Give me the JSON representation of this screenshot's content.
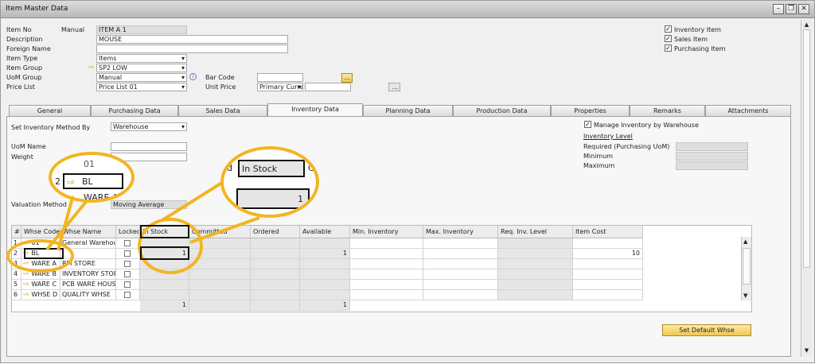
{
  "window": {
    "title": "Item Master Data"
  },
  "header": {
    "item_no_label": "Item No",
    "item_no_series": "Manual",
    "item_no_value": "ITEM A 1",
    "description_label": "Description",
    "description_value": "MOUSE",
    "foreign_name_label": "Foreign Name",
    "foreign_name_value": "",
    "item_type_label": "Item Type",
    "item_type_value": "Items",
    "item_group_label": "Item Group",
    "item_group_value": "SP2 LOW",
    "uom_group_label": "UoM Group",
    "uom_group_value": "Manual",
    "price_list_label": "Price List",
    "price_list_value": "Price List 01",
    "bar_code_label": "Bar Code",
    "bar_code_value": "",
    "unit_price_label": "Unit Price",
    "unit_price_currency": "Primary Curre",
    "unit_price_value": ""
  },
  "flags": [
    {
      "label": "Inventory Item",
      "checked": true
    },
    {
      "label": "Sales Item",
      "checked": true
    },
    {
      "label": "Purchasing Item",
      "checked": true
    }
  ],
  "tabs": [
    "General",
    "Purchasing Data",
    "Sales Data",
    "Inventory Data",
    "Planning Data",
    "Production Data",
    "Properties",
    "Remarks",
    "Attachments"
  ],
  "active_tab": "Inventory Data",
  "inventory": {
    "method_label": "Set Inventory Method By",
    "method_value": "Warehouse",
    "uom_name_label": "UoM Name",
    "weight_label": "Weight",
    "valuation_label": "Valuation Method",
    "valuation_value": "Moving Average",
    "manage_by_wh_label": "Manage Inventory by Warehouse",
    "manage_by_wh_checked": true,
    "level_title": "Inventory Level",
    "required_label": "Required (Purchasing UoM)",
    "minimum_label": "Minimum",
    "maximum_label": "Maximum"
  },
  "grid": {
    "columns": [
      "#",
      "Whse Code",
      "Whse Name",
      "Locked",
      "In Stock",
      "Committed",
      "Ordered",
      "Available",
      "Min. Inventory",
      "Max. Inventory",
      "Req. Inv. Level",
      "Item Cost"
    ],
    "rows": [
      {
        "num": "1",
        "code": "01",
        "name": "General Warehouse",
        "in_stock": "",
        "available": "",
        "cost": ""
      },
      {
        "num": "2",
        "code": "BL",
        "name": "",
        "in_stock": "1",
        "available": "1",
        "cost": "10"
      },
      {
        "num": "3",
        "code": "WARE A",
        "name": "RM STORE",
        "in_stock": "",
        "available": "",
        "cost": ""
      },
      {
        "num": "4",
        "code": "WARE B",
        "name": "INVENTORY STORE",
        "in_stock": "",
        "available": "",
        "cost": ""
      },
      {
        "num": "5",
        "code": "WARE C",
        "name": "PCB WARE HOUSE",
        "in_stock": "",
        "available": "",
        "cost": ""
      },
      {
        "num": "6",
        "code": "WHSE D",
        "name": "QUALITY WHSE",
        "in_stock": "",
        "available": "",
        "cost": ""
      }
    ],
    "total_in_stock": "1",
    "total_available": "1"
  },
  "zoom_left": {
    "row_top": "01",
    "row_num": "2",
    "code": "BL",
    "row_bottom": "WARE A"
  },
  "zoom_right": {
    "left_partial": "d",
    "header": "In Stock",
    "right_partial": "C",
    "value": "1"
  },
  "buttons": {
    "set_default": "Set Default Whse",
    "browse": "..."
  },
  "colors": {
    "annotation": "#f2b521",
    "button": "#f1c64f",
    "readonly": "#dedede"
  }
}
